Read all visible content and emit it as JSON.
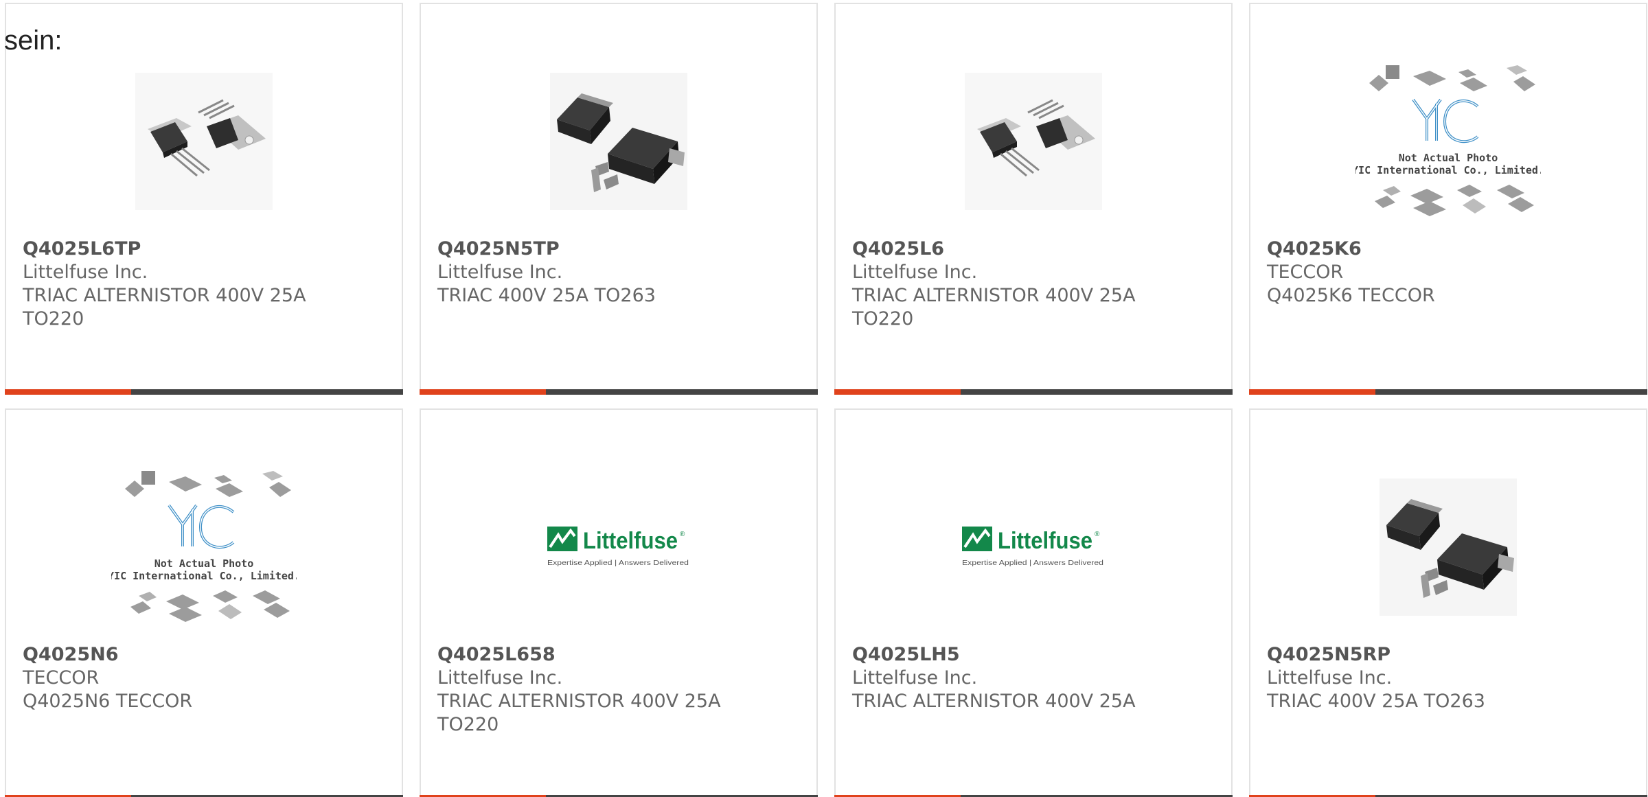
{
  "intro": {
    "text": "sein:"
  },
  "colors": {
    "accent_bar": "#e0421c",
    "dark_bar": "#444444",
    "littelfuse_green": "#13884a",
    "yic_blue": "#3d8fc7"
  },
  "cards": [
    {
      "part_number": "Q4025L6TP",
      "manufacturer": "Littelfuse Inc.",
      "description": "TRIAC ALTERNISTOR 400V 25A TO220",
      "image_type": "to220-photo"
    },
    {
      "part_number": "Q4025N5TP",
      "manufacturer": "Littelfuse Inc.",
      "description": "TRIAC 400V 25A TO263",
      "image_type": "to263-photo"
    },
    {
      "part_number": "Q4025L6",
      "manufacturer": "Littelfuse Inc.",
      "description": "TRIAC ALTERNISTOR 400V 25A TO220",
      "image_type": "to220-photo"
    },
    {
      "part_number": "Q4025K6",
      "manufacturer": "TECCOR",
      "description": "Q4025K6 TECCOR",
      "image_type": "yic-placeholder",
      "image_text_1": "Not Actual Photo",
      "image_text_2": "YIC International Co., Limited."
    },
    {
      "part_number": "Q4025N6",
      "manufacturer": "TECCOR",
      "description": "Q4025N6 TECCOR",
      "image_type": "yic-placeholder",
      "image_text_1": "Not Actual Photo",
      "image_text_2": "YIC International Co., Limited."
    },
    {
      "part_number": "Q4025L658",
      "manufacturer": "Littelfuse Inc.",
      "description": "TRIAC ALTERNISTOR 400V 25A TO220",
      "image_type": "littelfuse-logo",
      "logo_name": "Littelfuse",
      "logo_mark": "®",
      "logo_tagline": "Expertise Applied | Answers Delivered"
    },
    {
      "part_number": "Q4025LH5",
      "manufacturer": "Littelfuse Inc.",
      "description": "TRIAC ALTERNISTOR 400V 25A",
      "image_type": "littelfuse-logo",
      "logo_name": "Littelfuse",
      "logo_mark": "®",
      "logo_tagline": "Expertise Applied | Answers Delivered"
    },
    {
      "part_number": "Q4025N5RP",
      "manufacturer": "Littelfuse Inc.",
      "description": "TRIAC 400V 25A TO263",
      "image_type": "to263-photo"
    }
  ]
}
